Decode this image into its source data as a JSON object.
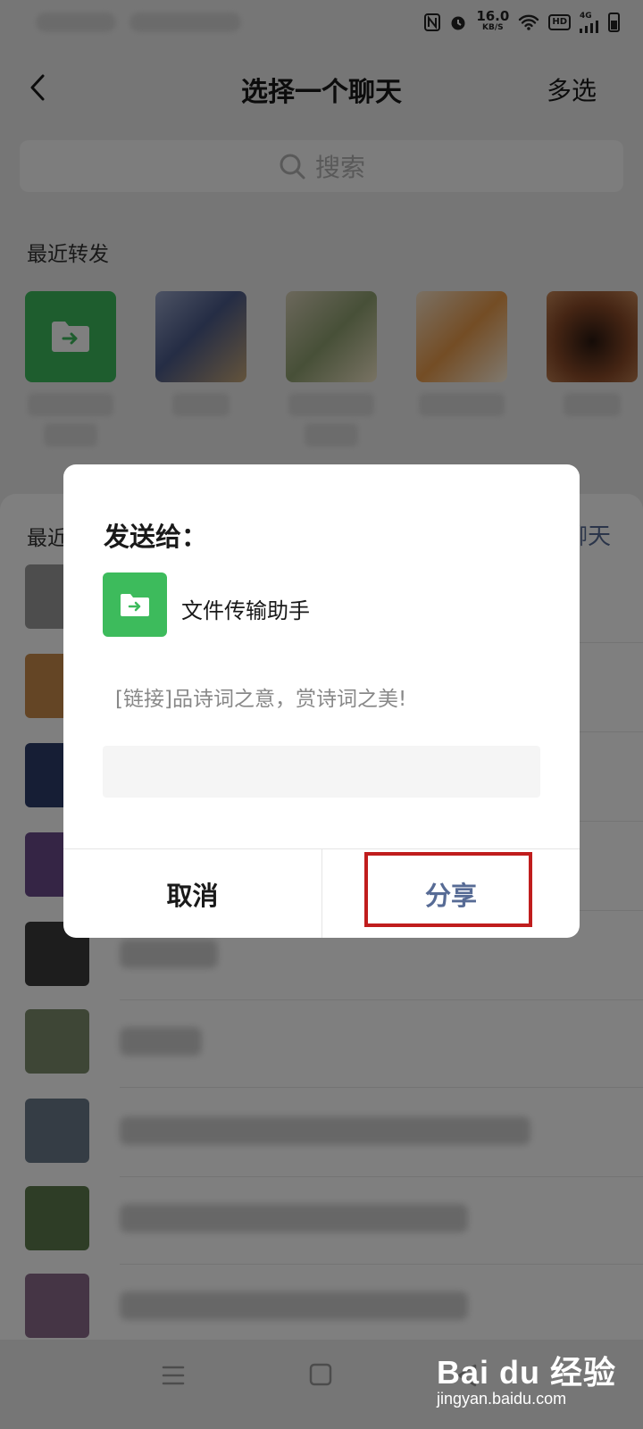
{
  "status_bar": {
    "speed_value": "16.0",
    "speed_unit": "KB/S",
    "hd_label": "HD",
    "network_label": "4G"
  },
  "nav": {
    "title": "选择一个聊天",
    "multi_select": "多选"
  },
  "search": {
    "placeholder": "搜索"
  },
  "recent_forwards": {
    "title": "最近转发",
    "avatar_colors": [
      "#3dbb5c",
      "#6f7aa8",
      "#a9b38a",
      "#e9a05a",
      "#5a3020"
    ]
  },
  "recent_chats": {
    "title_visible": "最近",
    "action_visible": "聊天",
    "avatar_colors": [
      "#9a9a9a",
      "#c98a4a",
      "#2d3d6a",
      "#6b4a8a",
      "#3a3a3a",
      "#7c8c6c",
      "#6a7a8a",
      "#5c7a4c",
      "#8a6a8a"
    ]
  },
  "dialog": {
    "title": "发送给：",
    "recipient_name": "文件传输助手",
    "message_preview": "[链接]品诗词之意，赏诗词之美!",
    "input_value": "",
    "cancel_label": "取消",
    "share_label": "分享"
  },
  "watermark": {
    "brand": "Bai du 经验",
    "url": "jingyan.baidu.com"
  },
  "colors": {
    "accent_link": "#576b95",
    "file_helper_green": "#3dbb5c",
    "highlight_red": "#c01d1d"
  }
}
